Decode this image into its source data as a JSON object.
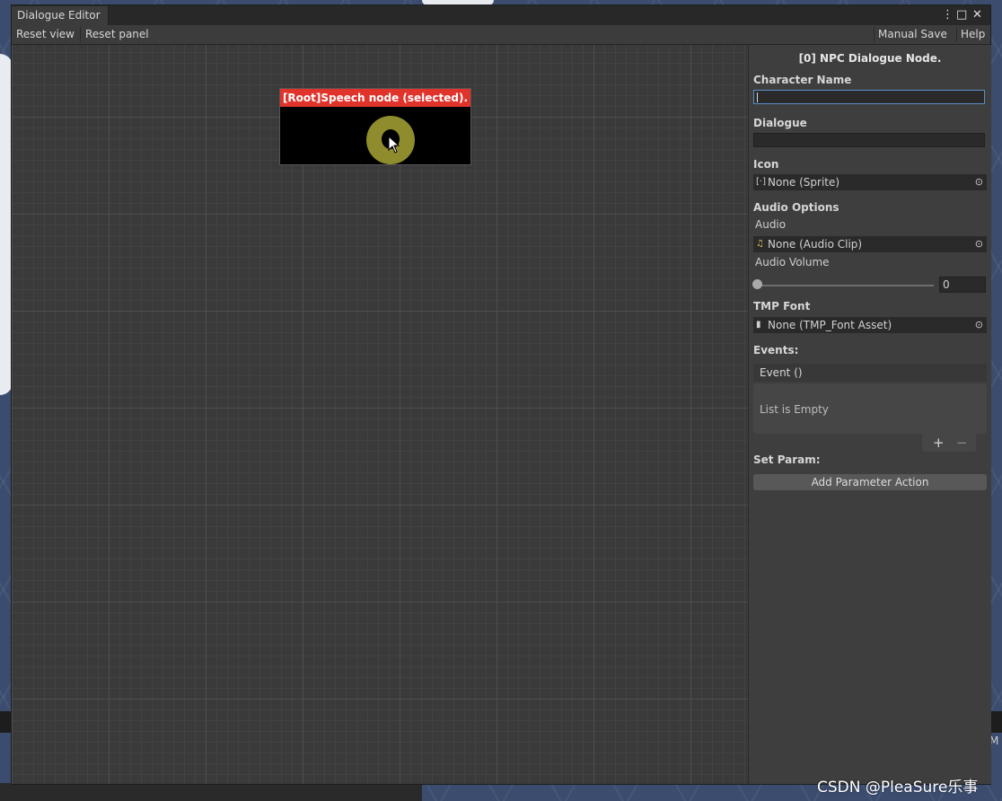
{
  "window": {
    "tab_title": "Dialogue Editor",
    "menu_glyph": "⋮",
    "maximize_glyph": "□",
    "close_glyph": "✕"
  },
  "toolbar": {
    "reset_view": "Reset view",
    "reset_panel": "Reset panel",
    "manual_save": "Manual Save",
    "help": "Help"
  },
  "canvas": {
    "node": {
      "header": "[Root]Speech node (selected).",
      "header_color": "#e0332c",
      "ring_color": "#8e8c2d"
    }
  },
  "inspector": {
    "title": "[0] NPC Dialogue Node.",
    "character_name_label": "Character Name",
    "character_name_value": "",
    "dialogue_label": "Dialogue",
    "dialogue_value": "",
    "icon_label": "Icon",
    "icon_value": "None (Sprite)",
    "audio_options_label": "Audio Options",
    "audio_label": "Audio",
    "audio_value": "None (Audio Clip)",
    "audio_volume_label": "Audio Volume",
    "audio_volume_value": "0",
    "tmp_font_label": "TMP Font",
    "tmp_font_value": "None (TMP_Font Asset)",
    "events_label": "Events:",
    "event_header": "Event ()",
    "list_empty": "List is Empty",
    "add_glyph": "+",
    "remove_glyph": "−",
    "set_param_label": "Set Param:",
    "add_parameter_action": "Add Parameter Action",
    "icons": {
      "sprite": "sprite-icon",
      "audio": "music-note-icon",
      "font": "file-icon",
      "picker": "object-picker-icon"
    }
  },
  "background": {
    "side_label": "M"
  },
  "watermark": "CSDN @PleaSure乐事"
}
